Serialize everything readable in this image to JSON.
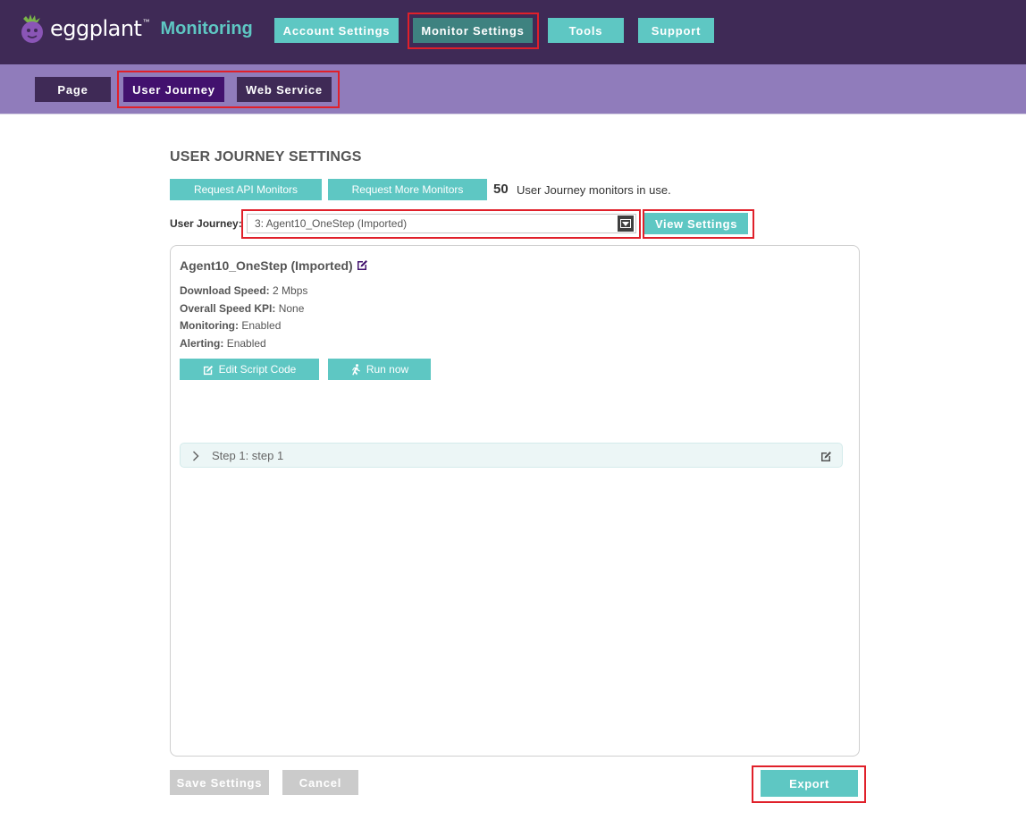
{
  "header": {
    "logo_text": "eggplant",
    "logo_tm": "™",
    "product_name": "Monitoring",
    "nav": [
      {
        "label": "Account Settings",
        "active": false
      },
      {
        "label": "Monitor Settings",
        "active": true
      },
      {
        "label": "Tools",
        "active": false
      },
      {
        "label": "Support",
        "active": false
      }
    ]
  },
  "subnav": {
    "tabs": [
      {
        "label": "Page",
        "active": false
      },
      {
        "label": "User Journey",
        "active": true
      },
      {
        "label": "Web Service",
        "active": false
      }
    ]
  },
  "main": {
    "title": "USER JOURNEY SETTINGS",
    "request_api_label": "Request API Monitors",
    "request_more_label": "Request More Monitors",
    "monitor_count": "50",
    "monitor_count_text": "User Journey monitors in use.",
    "user_journey_label": "User Journey:",
    "user_journey_selected": "3: Agent10_OneStep (Imported)",
    "view_settings_label": "View Settings"
  },
  "journey": {
    "name": "Agent10_OneStep (Imported)",
    "details": [
      {
        "label": "Download Speed:",
        "value": "2 Mbps"
      },
      {
        "label": "Overall Speed KPI:",
        "value": "None"
      },
      {
        "label": "Monitoring:",
        "value": "Enabled"
      },
      {
        "label": "Alerting:",
        "value": "Enabled"
      }
    ],
    "edit_script_label": "Edit Script Code",
    "run_now_label": "Run now",
    "steps": [
      {
        "label": "Step 1: step 1"
      }
    ]
  },
  "footer": {
    "save_label": "Save Settings",
    "cancel_label": "Cancel",
    "export_label": "Export"
  },
  "colors": {
    "header_bg": "#3f2a56",
    "subnav_bg": "#907cbb",
    "teal": "#5ec7c3",
    "active_nav": "#3e8280",
    "active_tab": "#42116e",
    "highlight": "#e0202a"
  },
  "icons": {
    "logo": "eggplant-logo-icon",
    "edit": "edit-icon",
    "run": "running-person-icon",
    "chevron": "chevron-right-icon",
    "dropdown": "dropdown-caret-icon"
  }
}
